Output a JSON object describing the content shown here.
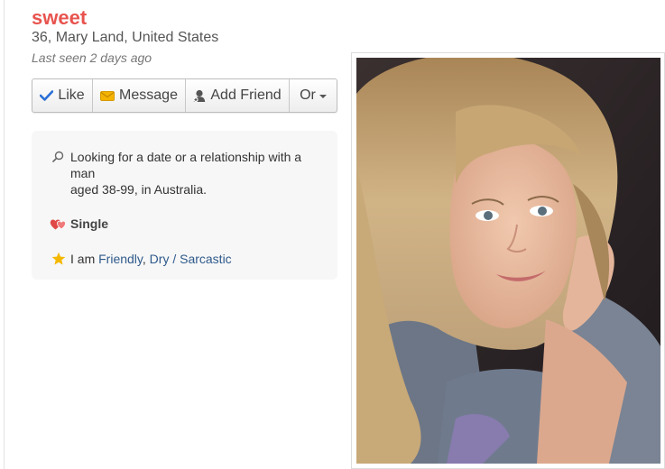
{
  "profile": {
    "name": "sweet",
    "location": "36, Mary Land, United States",
    "last_seen": "Last seen 2 days ago"
  },
  "actions": {
    "like": "Like",
    "message": "Message",
    "add_friend": "Add Friend",
    "more": "Or"
  },
  "details": {
    "looking_for_line1": "Looking for a date or a relationship with a man",
    "looking_for_line2": "aged 38-99, in Australia.",
    "status": "Single",
    "traits_prefix": "I am",
    "traits": [
      "Friendly",
      "Dry / Sarcastic"
    ],
    "traits_separator": ","
  },
  "icons": {
    "like": "check-icon",
    "message": "envelope-icon",
    "add_friend": "person-add-icon",
    "more": "caret-down-icon",
    "looking_for": "search-icon",
    "status": "hearts-icon",
    "traits": "star-icon"
  },
  "colors": {
    "name": "#e8544f",
    "link": "#2f5a8b",
    "check": "#2a6fd6",
    "envelope": "#f4b300",
    "hearts": "#e04848",
    "star": "#f5b800"
  },
  "photo": {
    "alt": "Profile photo"
  }
}
